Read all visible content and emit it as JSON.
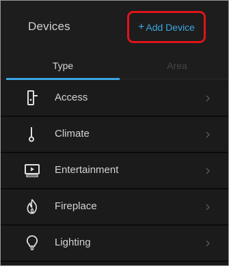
{
  "header": {
    "title": "Devices",
    "add_button_label": "Add Device"
  },
  "tabs": [
    {
      "label": "Type",
      "active": true
    },
    {
      "label": "Area",
      "active": false
    }
  ],
  "device_types": [
    {
      "label": "Access",
      "icon": "door-lock-icon"
    },
    {
      "label": "Climate",
      "icon": "thermometer-icon"
    },
    {
      "label": "Entertainment",
      "icon": "tv-icon"
    },
    {
      "label": "Fireplace",
      "icon": "flame-icon"
    },
    {
      "label": "Lighting",
      "icon": "lightbulb-icon"
    }
  ],
  "colors": {
    "accent": "#3aa7e4",
    "highlight_box": "#e0141a",
    "background": "#191919",
    "text": "#d4d4d4",
    "inactive_tab": "#454545"
  }
}
